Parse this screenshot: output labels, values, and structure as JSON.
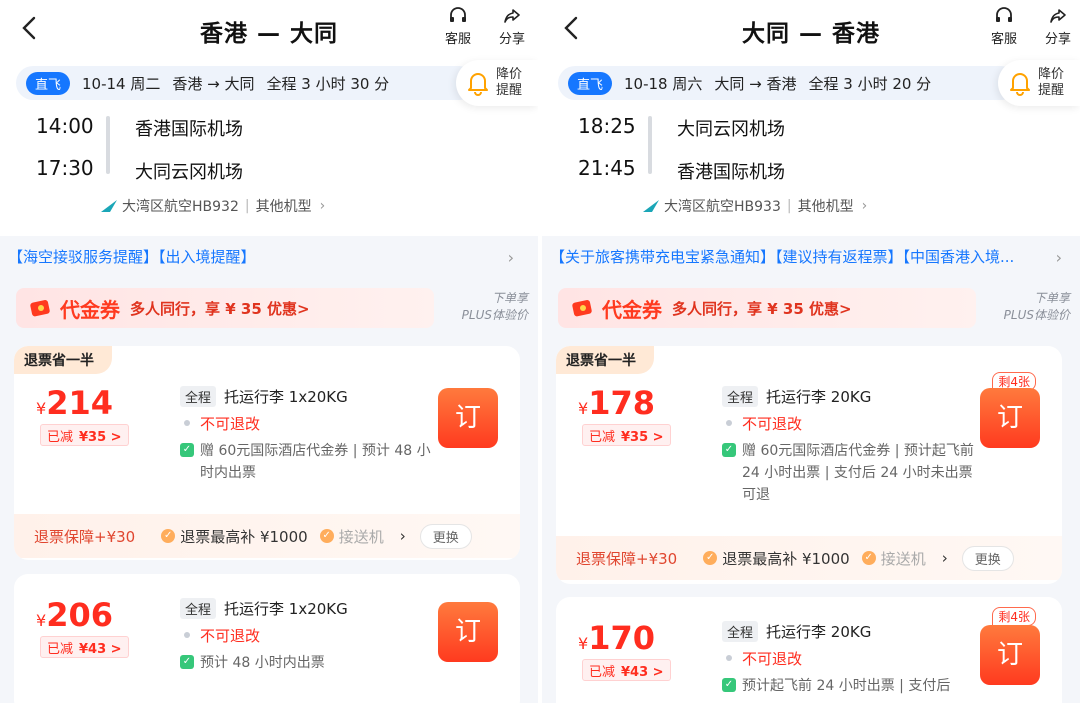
{
  "left": {
    "title": "香港 — 大同",
    "service_label": "客服",
    "share_label": "分享",
    "direct_tag": "直飞",
    "date": "10-14 周二",
    "route": "香港 → 大同",
    "duration": "全程 3 小时 30 分",
    "remind_label_1": "降价",
    "remind_label_2": "提醒",
    "dep_time": "14:00",
    "dep_airport": "香港国际机场",
    "arr_time": "17:30",
    "arr_airport": "大同云冈机场",
    "airline": "大湾区航空HB932",
    "aircraft": "其他机型",
    "notice": "【海空接驳服务提醒】【出入境提醒】",
    "coupon_title": "代金券",
    "coupon_desc": "多人同行，享 ¥ 35 优惠>",
    "plus_1": "下单享",
    "plus_2": "PLUS体验价",
    "cards": [
      {
        "badge": "退票省一半",
        "yen": "¥",
        "price": "214",
        "disc_label": "已减",
        "disc_amount": "¥35 >",
        "chip": "全程",
        "baggage": "托运行李 1x20KG",
        "refund": "不可退改",
        "benefit": "赠 60元国际酒店代金券 | 预计 48 小时内出票",
        "book": "订",
        "guar": "退票保障+¥30",
        "guar_2": "退票最高补 ¥1000",
        "guar_3": "接送机",
        "change": "更换"
      },
      {
        "yen": "¥",
        "price": "206",
        "disc_label": "已减",
        "disc_amount": "¥43 >",
        "chip": "全程",
        "baggage": "托运行李 1x20KG",
        "refund": "不可退改",
        "benefit": "预计 48 小时内出票",
        "book": "订"
      }
    ]
  },
  "right": {
    "title": "大同 — 香港",
    "service_label": "客服",
    "share_label": "分享",
    "direct_tag": "直飞",
    "date": "10-18 周六",
    "route": "大同 → 香港",
    "duration": "全程 3 小时 20 分",
    "remind_label_1": "降价",
    "remind_label_2": "提醒",
    "dep_time": "18:25",
    "dep_airport": "大同云冈机场",
    "arr_time": "21:45",
    "arr_airport": "香港国际机场",
    "airline": "大湾区航空HB933",
    "aircraft": "其他机型",
    "notice": "【关于旅客携带充电宝紧急通知】【建议持有返程票】【中国香港入境...",
    "coupon_title": "代金券",
    "coupon_desc": "多人同行，享 ¥ 35 优惠>",
    "plus_1": "下单享",
    "plus_2": "PLUS体验价",
    "cards": [
      {
        "badge": "退票省一半",
        "yen": "¥",
        "price": "178",
        "disc_label": "已减",
        "disc_amount": "¥35 >",
        "chip": "全程",
        "baggage": "托运行李 20KG",
        "refund": "不可退改",
        "benefit": "赠 60元国际酒店代金券 | 预计起飞前 24 小时出票 | 支付后 24 小时未出票可退",
        "left_tag": "剩4张",
        "book": "订",
        "guar": "退票保障+¥30",
        "guar_2": "退票最高补 ¥1000",
        "guar_3": "接送机",
        "change": "更换"
      },
      {
        "yen": "¥",
        "price": "170",
        "disc_label": "已减",
        "disc_amount": "¥43 >",
        "chip": "全程",
        "baggage": "托运行李 20KG",
        "refund": "不可退改",
        "benefit": "预计起飞前 24 小时出票 | 支付后",
        "left_tag": "剩4张",
        "book": "订"
      }
    ]
  },
  "icons": {
    "back": "chevron-left-icon",
    "service": "headset-icon",
    "share": "share-icon",
    "bell": "bell-icon",
    "airline": "airline-logo-icon",
    "coupon": "coupon-icon"
  },
  "colors": {
    "accent_blue": "#1677ff",
    "price_red": "#ff2d1f",
    "book_orange": "#ff5a2a",
    "bg": "#f4f6fa"
  }
}
